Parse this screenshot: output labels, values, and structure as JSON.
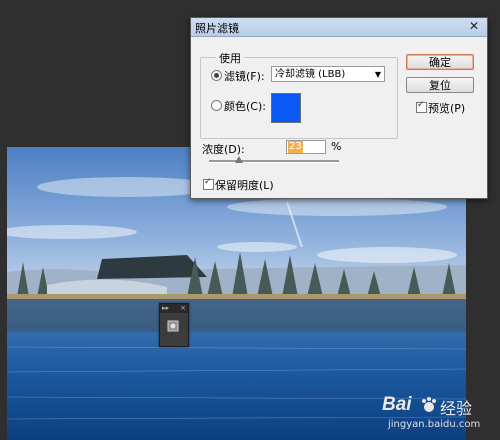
{
  "dialog": {
    "title": "照片滤镜",
    "close_icon": "close-icon",
    "use_group_label": "使用",
    "filter_label": "滤镜(F):",
    "filter_selected": "冷却滤镜 (LBB)",
    "color_label": "颜色(C):",
    "color_swatch_hex": "#0a5bf5",
    "ok_label": "确定",
    "reset_label": "复位",
    "preview_label": "预览(P)",
    "preview_checked": true,
    "density_label": "浓度(D):",
    "density_value": "23",
    "density_unit": "%",
    "density_fraction": 0.23,
    "preserve_label": "保留明度(L)",
    "preserve_checked": true,
    "filter_radio_selected": true
  },
  "mini_panel": {
    "header_left": "▸▸",
    "header_right": "×",
    "icon": "adjustment-icon"
  },
  "watermark": {
    "brand": "Bai",
    "brand2": "经验",
    "site": "jingyan.baidu.com"
  }
}
